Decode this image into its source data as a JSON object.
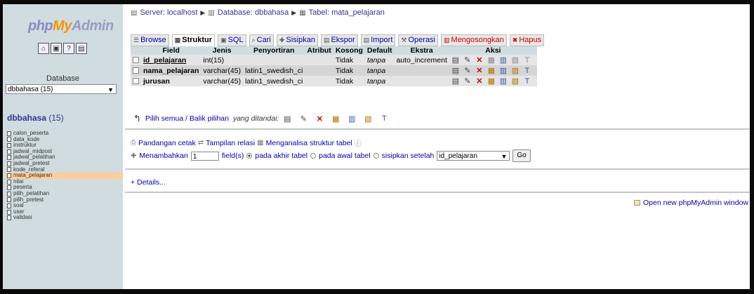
{
  "app": {
    "logo": {
      "php": "php",
      "my": "My",
      "admin": "Admin"
    },
    "colors": {
      "sidebar_bg": "#d0dce0",
      "active_table": "#ffcc99",
      "link": "#0000aa",
      "danger": "#cc0000"
    }
  },
  "sidebar": {
    "quick_icons": [
      "home-icon",
      "sql-query-icon",
      "docs-icon",
      "changelog-icon"
    ],
    "database_label": "Database",
    "database_select": "dbbahasa (15)",
    "db_name": "dbbahasa",
    "db_count": "(15)",
    "tables": [
      "calon_peserta",
      "data_kode",
      "instruktur",
      "jadwal_midpost",
      "jadwal_pelatihan",
      "jadwal_pretest",
      "kode_referal",
      "mata_pelajaran",
      "nilai",
      "peserta",
      "pilih_pelatihan",
      "pilih_pretest",
      "soal",
      "user",
      "validasi"
    ],
    "active_table": "mata_pelajaran"
  },
  "breadcrumb": {
    "server": "Server: localhost",
    "database": "Database: dbbahasa",
    "table": "Tabel: mata_pelajaran"
  },
  "tabs": [
    {
      "label": "Browse",
      "icon": "browse-icon"
    },
    {
      "label": "Struktur",
      "icon": "structure-icon"
    },
    {
      "label": "SQL",
      "icon": "sql-icon"
    },
    {
      "label": "Cari",
      "icon": "search-icon"
    },
    {
      "label": "Sisipkan",
      "icon": "insert-icon"
    },
    {
      "label": "Ekspor",
      "icon": "export-icon"
    },
    {
      "label": "Import",
      "icon": "import-icon"
    },
    {
      "label": "Operasi",
      "icon": "operations-icon"
    },
    {
      "label": "Mengosongkan",
      "icon": "empty-icon"
    },
    {
      "label": "Hapus",
      "icon": "drop-icon"
    }
  ],
  "structure": {
    "headers": {
      "field": "Field",
      "jenis": "Jenis",
      "penyortiran": "Penyortiran",
      "atribut": "Atribut",
      "kosong": "Kosong",
      "default": "Default",
      "ekstra": "Ekstra",
      "aksi": "Aksi"
    },
    "rows": [
      {
        "field": "id_pelajaran",
        "jenis": "int(15)",
        "penyortiran": "",
        "atribut": "",
        "kosong": "Tidak",
        "default": "tanpa",
        "ekstra": "auto_increment"
      },
      {
        "field": "nama_pelajaran",
        "jenis": "varchar(45)",
        "penyortiran": "latin1_swedish_ci",
        "atribut": "",
        "kosong": "Tidak",
        "default": "tanpa",
        "ekstra": ""
      },
      {
        "field": "jurusan",
        "jenis": "varchar(45)",
        "penyortiran": "latin1_swedish_ci",
        "atribut": "",
        "kosong": "Tidak",
        "default": "tanpa",
        "ekstra": ""
      }
    ],
    "select_all_text": "Pilih semua / Balik pilihan",
    "with_selected_text": "yang ditandai:"
  },
  "links": {
    "print_view": "Pandangan cetak",
    "relation_view": "Tampilan relasi",
    "propose_structure": "Menganalisa struktur tabel"
  },
  "add_fields": {
    "label": "Menambahkan",
    "count_value": "1",
    "fields_text": "field(s)",
    "at_end": "pada akhir tabel",
    "at_beginning": "pada awal tabel",
    "after": "sisipkan setelah",
    "after_select": "id_pelajaran",
    "go": "Go"
  },
  "details": "+ Details...",
  "open_new": "Open new phpMyAdmin window"
}
